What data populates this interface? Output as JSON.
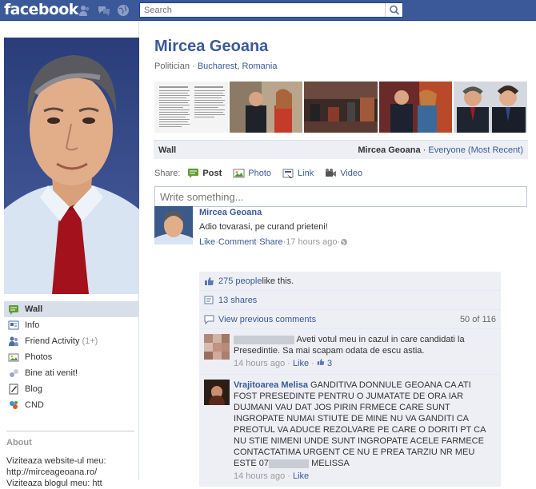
{
  "topbar": {
    "logo": "facebook",
    "search_placeholder": "Search"
  },
  "leftnav": {
    "items": [
      {
        "label": "Wall",
        "icon": "wall-icon"
      },
      {
        "label": "Info",
        "icon": "info-icon"
      },
      {
        "label": "Friend Activity",
        "count": "(1+)",
        "icon": "friends-icon"
      },
      {
        "label": "Photos",
        "icon": "photos-icon"
      },
      {
        "label": "Bine ati venit!",
        "icon": "welcome-icon"
      },
      {
        "label": "Blog",
        "icon": "blog-icon"
      },
      {
        "label": "CND",
        "icon": "cnd-icon"
      }
    ]
  },
  "about": {
    "title": "About",
    "lines": [
      "Viziteaza website-ul meu:",
      "http://mirceageoana.ro/",
      "Viziteaza blogul meu: htt"
    ]
  },
  "profile": {
    "name": "Mircea Geoana",
    "category": "Politician",
    "separator": " · ",
    "location": "Bucharest, Romania"
  },
  "wall": {
    "label": "Wall",
    "filter_name": "Mircea Geoana",
    "filter_sep": " · ",
    "filter_scope": "Everyone (Most Recent)"
  },
  "share": {
    "label": "Share:",
    "options": [
      "Post",
      "Photo",
      "Link",
      "Video"
    ],
    "composer_placeholder": "Write something..."
  },
  "story": {
    "author": "Mircea Geoana",
    "message": "Adio tovarasi, pe curand prieteni!",
    "actions": [
      "Like",
      "Comment",
      "Share"
    ],
    "time": "17 hours ago",
    "sep": " · ",
    "likes_count": "275 people",
    "likes_suffix": " like this.",
    "shares": "13 shares",
    "view_prev": "View previous comments",
    "comment_count": "50 of 116"
  },
  "comments": [
    {
      "author_hidden": true,
      "text": "Aveti votul meu in cazul in care candidati la Presedintie. Sa mai scapam odata de escu astia.",
      "time": "14 hours ago",
      "like": "Like",
      "likes": "3"
    },
    {
      "author": "Vrajitoarea Melisa",
      "text_a": "GANDITIVA DONNULE GEOANA CA ATI FOST PRESEDINTE PENTRU O JUMATATE DE ORA IAR DUJMANI VAU DAT JOS PIRIN FRMECE CARE SUNT INGROPATE NUMAI STIUTE DE MINE NU VA GANDITI CA PREOTUL VA ADUCE REZOLVARE PE CARE O DORITI PT CA NU STIE NIMENI UNDE SUNT INGROPATE ACELE FARMECE CONTACTATIMA URGENT CE NU E PREA TARZIU NR MEU ESTE 07",
      "text_b": "MELISSA",
      "time": "14 hours ago",
      "like": "Like"
    }
  ],
  "colors": {
    "brand": "#3b5998",
    "panel": "#edeff4",
    "nav_active": "#d8dfea"
  }
}
